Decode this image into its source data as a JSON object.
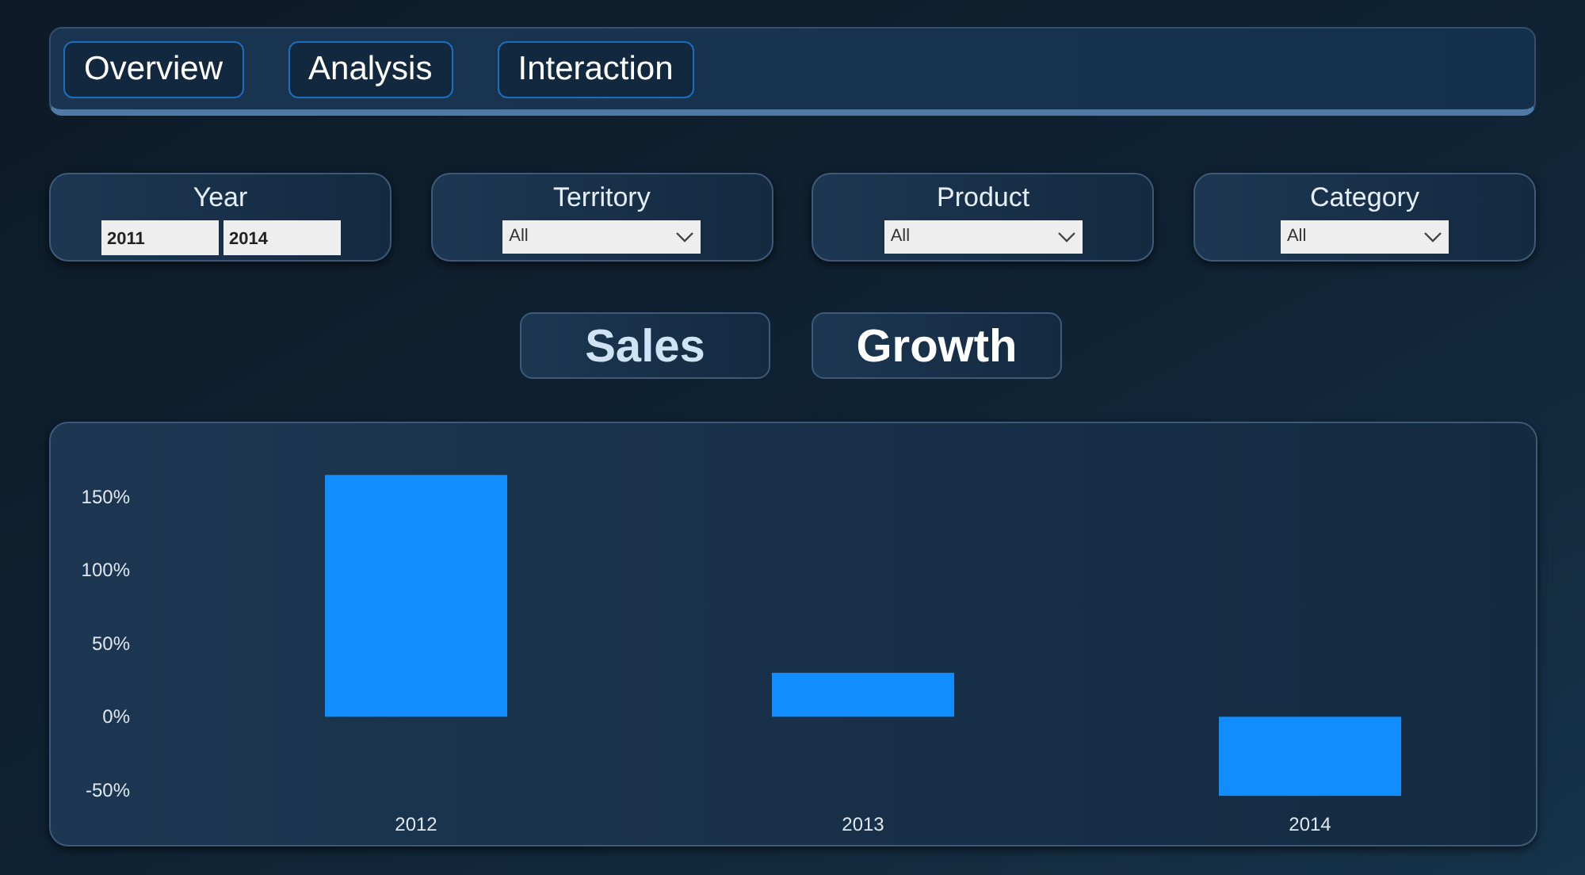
{
  "nav_tabs": [
    {
      "label": "Overview",
      "selected": false
    },
    {
      "label": "Analysis",
      "selected": false
    },
    {
      "label": "Interaction",
      "selected": false
    }
  ],
  "filters": [
    {
      "kind": "range",
      "label": "Year",
      "from": "2011",
      "to": "2014"
    },
    {
      "kind": "dropdown",
      "label": "Territory",
      "value": "All"
    },
    {
      "kind": "dropdown",
      "label": "Product",
      "value": "All"
    },
    {
      "kind": "dropdown",
      "label": "Category",
      "value": "All"
    }
  ],
  "view_buttons": [
    {
      "label": "Sales",
      "selected": false
    },
    {
      "label": "Growth",
      "selected": true
    }
  ],
  "chart": {
    "chart_data": {
      "type": "bar",
      "categories": [
        "2012",
        "2013",
        "2014"
      ],
      "series": [
        {
          "color": "#118dff",
          "values": [
            165,
            30,
            -54
          ]
        }
      ],
      "ylim": [
        -55,
        170
      ],
      "yticks": [
        {
          "value": -50,
          "label": "-50%"
        },
        {
          "value": 0,
          "label": "0%"
        },
        {
          "value": 50,
          "label": "50%"
        },
        {
          "value": 100,
          "label": "100%"
        },
        {
          "value": 150,
          "label": "150%"
        }
      ]
    }
  }
}
